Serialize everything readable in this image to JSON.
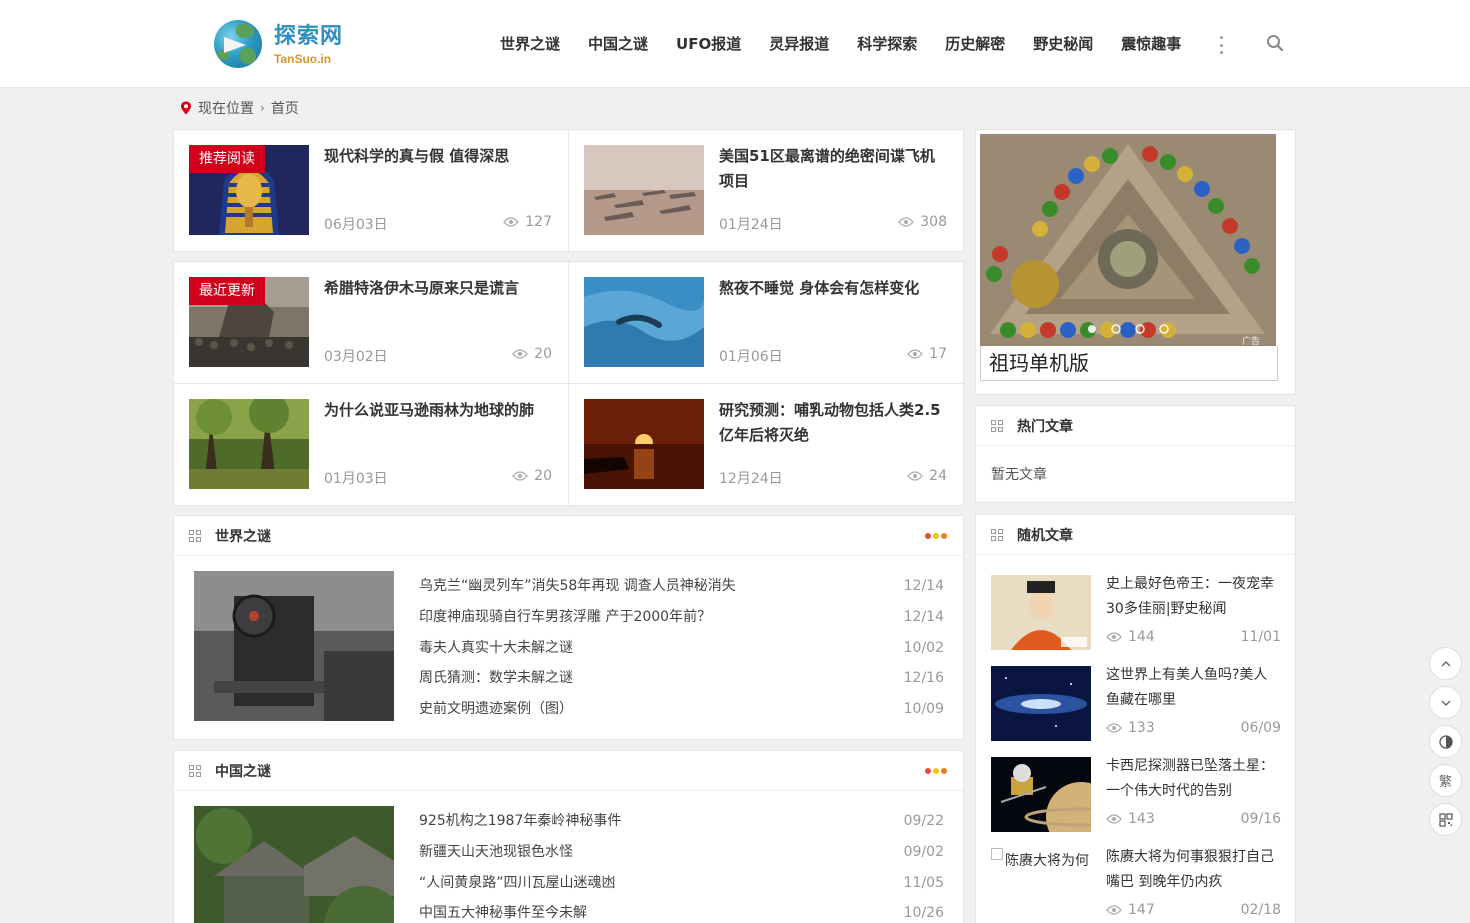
{
  "header": {
    "logo_cn": "探索网",
    "logo_en": "TanSuo.in",
    "nav": [
      "世界之谜",
      "中国之谜",
      "UFO报道",
      "灵异报道",
      "科学探索",
      "历史解密",
      "野史秘闻",
      "震惊趣事"
    ]
  },
  "breadcrumb": {
    "label": "现在位置",
    "current": "首页"
  },
  "featured": [
    {
      "tag": "推荐阅读",
      "title": "现代科学的真与假 值得深思",
      "date": "06月03日",
      "views": "127"
    },
    {
      "tag": "",
      "title": "美国51区最离谱的绝密间谍飞机项目",
      "date": "01月24日",
      "views": "308"
    },
    {
      "tag": "最近更新",
      "title": "希腊特洛伊木马原来只是谎言",
      "date": "03月02日",
      "views": "20"
    },
    {
      "tag": "",
      "title": "熬夜不睡觉 身体会有怎样变化",
      "date": "01月06日",
      "views": "17"
    },
    {
      "tag": "",
      "title": "为什么说亚马逊雨林为地球的肺",
      "date": "01月03日",
      "views": "20"
    },
    {
      "tag": "",
      "title": "研究预测：哺乳动物包括人类2.5亿年后将灭绝",
      "date": "12月24日",
      "views": "24"
    }
  ],
  "sections": [
    {
      "title": "世界之谜",
      "items": [
        {
          "title": "乌克兰“幽灵列车”消失58年再现 调查人员神秘消失",
          "date": "12/14"
        },
        {
          "title": "印度神庙现骑自行车男孩浮雕 产于2000年前？",
          "date": "12/14"
        },
        {
          "title": "毒夫人真实十大未解之谜",
          "date": "10/02"
        },
        {
          "title": "周氏猜测：数学未解之谜",
          "date": "12/16"
        },
        {
          "title": "史前文明遗迹案例（图）",
          "date": "10/09"
        }
      ]
    },
    {
      "title": "中国之谜",
      "items": [
        {
          "title": "925机构之1987年秦岭神秘事件",
          "date": "09/22"
        },
        {
          "title": "新疆天山天池现银色水怪",
          "date": "09/02"
        },
        {
          "title": "“人间黄泉路”四川瓦屋山迷魂凼",
          "date": "11/05"
        },
        {
          "title": "中国五大神秘事件至今未解",
          "date": "10/26"
        }
      ]
    }
  ],
  "sidebar": {
    "ad_caption": "祖玛单机版",
    "ad_mark": "广告",
    "hot": {
      "title": "热门文章",
      "empty": "暂无文章"
    },
    "random": {
      "title": "随机文章",
      "items": [
        {
          "title": "史上最好色帝王：一夜宠幸30多佳丽|野史秘闻",
          "views": "144",
          "date": "11/01"
        },
        {
          "title": "这世界上有美人鱼吗?美人鱼藏在哪里",
          "views": "133",
          "date": "06/09"
        },
        {
          "title": "卡西尼探测器已坠落土星：一个伟大时代的告别",
          "views": "143",
          "date": "09/16"
        },
        {
          "title": "陈赓大将为何事狠狠打自己嘴巴 到晚年仍内疚",
          "views": "147",
          "date": "02/18",
          "img_alt": "陈赓大将为何"
        }
      ]
    }
  },
  "float_buttons": {
    "trad": "繁"
  },
  "colors": {
    "tag_red": "#d0021b",
    "logo_blue": "#2f8fc4",
    "logo_orange": "#d4962f",
    "dot1": "#e74c3c",
    "dot2": "#f1c40f",
    "dot3": "#e67e22"
  }
}
